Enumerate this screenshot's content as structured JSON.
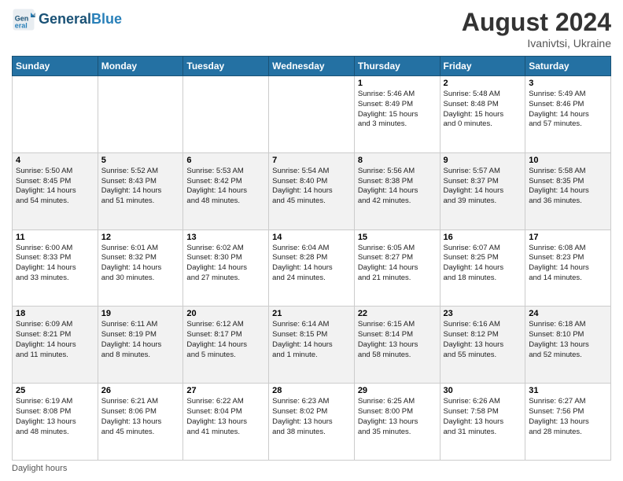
{
  "header": {
    "logo_line1": "General",
    "logo_line2": "Blue",
    "month_year": "August 2024",
    "location": "Ivanivtsi, Ukraine"
  },
  "days_of_week": [
    "Sunday",
    "Monday",
    "Tuesday",
    "Wednesday",
    "Thursday",
    "Friday",
    "Saturday"
  ],
  "weeks": [
    [
      {
        "day": "",
        "info": ""
      },
      {
        "day": "",
        "info": ""
      },
      {
        "day": "",
        "info": ""
      },
      {
        "day": "",
        "info": ""
      },
      {
        "day": "1",
        "info": "Sunrise: 5:46 AM\nSunset: 8:49 PM\nDaylight: 15 hours\nand 3 minutes."
      },
      {
        "day": "2",
        "info": "Sunrise: 5:48 AM\nSunset: 8:48 PM\nDaylight: 15 hours\nand 0 minutes."
      },
      {
        "day": "3",
        "info": "Sunrise: 5:49 AM\nSunset: 8:46 PM\nDaylight: 14 hours\nand 57 minutes."
      }
    ],
    [
      {
        "day": "4",
        "info": "Sunrise: 5:50 AM\nSunset: 8:45 PM\nDaylight: 14 hours\nand 54 minutes."
      },
      {
        "day": "5",
        "info": "Sunrise: 5:52 AM\nSunset: 8:43 PM\nDaylight: 14 hours\nand 51 minutes."
      },
      {
        "day": "6",
        "info": "Sunrise: 5:53 AM\nSunset: 8:42 PM\nDaylight: 14 hours\nand 48 minutes."
      },
      {
        "day": "7",
        "info": "Sunrise: 5:54 AM\nSunset: 8:40 PM\nDaylight: 14 hours\nand 45 minutes."
      },
      {
        "day": "8",
        "info": "Sunrise: 5:56 AM\nSunset: 8:38 PM\nDaylight: 14 hours\nand 42 minutes."
      },
      {
        "day": "9",
        "info": "Sunrise: 5:57 AM\nSunset: 8:37 PM\nDaylight: 14 hours\nand 39 minutes."
      },
      {
        "day": "10",
        "info": "Sunrise: 5:58 AM\nSunset: 8:35 PM\nDaylight: 14 hours\nand 36 minutes."
      }
    ],
    [
      {
        "day": "11",
        "info": "Sunrise: 6:00 AM\nSunset: 8:33 PM\nDaylight: 14 hours\nand 33 minutes."
      },
      {
        "day": "12",
        "info": "Sunrise: 6:01 AM\nSunset: 8:32 PM\nDaylight: 14 hours\nand 30 minutes."
      },
      {
        "day": "13",
        "info": "Sunrise: 6:02 AM\nSunset: 8:30 PM\nDaylight: 14 hours\nand 27 minutes."
      },
      {
        "day": "14",
        "info": "Sunrise: 6:04 AM\nSunset: 8:28 PM\nDaylight: 14 hours\nand 24 minutes."
      },
      {
        "day": "15",
        "info": "Sunrise: 6:05 AM\nSunset: 8:27 PM\nDaylight: 14 hours\nand 21 minutes."
      },
      {
        "day": "16",
        "info": "Sunrise: 6:07 AM\nSunset: 8:25 PM\nDaylight: 14 hours\nand 18 minutes."
      },
      {
        "day": "17",
        "info": "Sunrise: 6:08 AM\nSunset: 8:23 PM\nDaylight: 14 hours\nand 14 minutes."
      }
    ],
    [
      {
        "day": "18",
        "info": "Sunrise: 6:09 AM\nSunset: 8:21 PM\nDaylight: 14 hours\nand 11 minutes."
      },
      {
        "day": "19",
        "info": "Sunrise: 6:11 AM\nSunset: 8:19 PM\nDaylight: 14 hours\nand 8 minutes."
      },
      {
        "day": "20",
        "info": "Sunrise: 6:12 AM\nSunset: 8:17 PM\nDaylight: 14 hours\nand 5 minutes."
      },
      {
        "day": "21",
        "info": "Sunrise: 6:14 AM\nSunset: 8:15 PM\nDaylight: 14 hours\nand 1 minute."
      },
      {
        "day": "22",
        "info": "Sunrise: 6:15 AM\nSunset: 8:14 PM\nDaylight: 13 hours\nand 58 minutes."
      },
      {
        "day": "23",
        "info": "Sunrise: 6:16 AM\nSunset: 8:12 PM\nDaylight: 13 hours\nand 55 minutes."
      },
      {
        "day": "24",
        "info": "Sunrise: 6:18 AM\nSunset: 8:10 PM\nDaylight: 13 hours\nand 52 minutes."
      }
    ],
    [
      {
        "day": "25",
        "info": "Sunrise: 6:19 AM\nSunset: 8:08 PM\nDaylight: 13 hours\nand 48 minutes."
      },
      {
        "day": "26",
        "info": "Sunrise: 6:21 AM\nSunset: 8:06 PM\nDaylight: 13 hours\nand 45 minutes."
      },
      {
        "day": "27",
        "info": "Sunrise: 6:22 AM\nSunset: 8:04 PM\nDaylight: 13 hours\nand 41 minutes."
      },
      {
        "day": "28",
        "info": "Sunrise: 6:23 AM\nSunset: 8:02 PM\nDaylight: 13 hours\nand 38 minutes."
      },
      {
        "day": "29",
        "info": "Sunrise: 6:25 AM\nSunset: 8:00 PM\nDaylight: 13 hours\nand 35 minutes."
      },
      {
        "day": "30",
        "info": "Sunrise: 6:26 AM\nSunset: 7:58 PM\nDaylight: 13 hours\nand 31 minutes."
      },
      {
        "day": "31",
        "info": "Sunrise: 6:27 AM\nSunset: 7:56 PM\nDaylight: 13 hours\nand 28 minutes."
      }
    ]
  ],
  "footer": {
    "note": "Daylight hours"
  }
}
